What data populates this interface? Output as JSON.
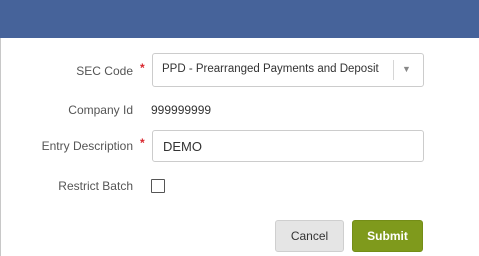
{
  "form": {
    "sec_code": {
      "label": "SEC Code",
      "selected": "PPD - Prearranged Payments and Deposit",
      "required_mark": "*"
    },
    "company_id": {
      "label": "Company Id",
      "value": "999999999"
    },
    "entry_description": {
      "label": "Entry Description",
      "value": "DEMO",
      "required_mark": "*"
    },
    "restrict_batch": {
      "label": "Restrict Batch",
      "checked": false
    }
  },
  "actions": {
    "cancel_label": "Cancel",
    "submit_label": "Submit"
  },
  "colors": {
    "header": "#46639a",
    "submit": "#7f9a1c",
    "required": "#d9272e"
  },
  "icons": {
    "select_arrow": "chevron-down-icon"
  }
}
